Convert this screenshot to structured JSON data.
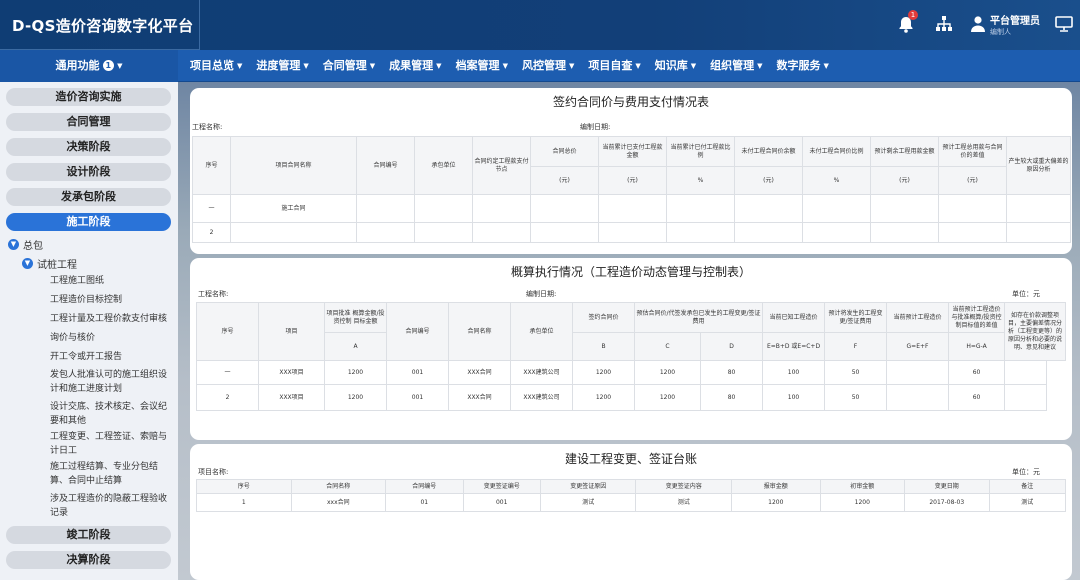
{
  "app": {
    "title": "D-QS造价咨询数字化平台",
    "notification_count": "1",
    "user_name": "平台管理员",
    "user_role": "编制人"
  },
  "nav": {
    "common": "通用功能",
    "common_count": "1",
    "items": [
      "项目总览",
      "进度管理",
      "合同管理",
      "成果管理",
      "档案管理",
      "风控管理",
      "项目自查",
      "知识库",
      "组织管理",
      "数字服务"
    ]
  },
  "sidebar": {
    "top_stages": [
      "造价咨询实施",
      "合同管理",
      "决策阶段",
      "设计阶段",
      "发承包阶段",
      "施工阶段"
    ],
    "tree": {
      "root": "总包",
      "child": "试桩工程"
    },
    "sub_items": [
      "工程施工图纸",
      "工程造价目标控制",
      "工程计量及工程价款支付审核",
      "询价与核价",
      "开工令或开工报告",
      "发包人批准认可的施工组织设计和施工进度计划",
      "设计交底、技术核定、会议纪要和其他",
      "工程变更、工程签证、索赔与计日工",
      "施工过程结算、专业分包结算、合同中止结算",
      "涉及工程造价的隐蔽工程验收记录"
    ],
    "bottom_stages": [
      "竣工阶段",
      "决算阶段"
    ]
  },
  "panel1": {
    "title": "签约合同价与费用支付情况表",
    "project_label": "工程名称:",
    "date_label": "编制日期:",
    "headers": [
      "序号",
      "项目合同名称",
      "合同编号",
      "承包单位",
      "合同约定工程款支付节点",
      "合同总价",
      "当前累计已支付工程款金额",
      "当前累计已付工程款比例",
      "未付工程合同价余额",
      "未付工程合同价比例",
      "预计剩余工程用款金额",
      "预计工程总用款与合同价的差值",
      "产生较大或重大偏差的原因分析"
    ],
    "units": [
      "(元)",
      "(元)",
      "%",
      "(元)",
      "%",
      "(元)",
      "(元)"
    ],
    "rows": [
      [
        "一",
        "施工合同",
        "",
        "",
        "",
        "",
        "",
        "",
        "",
        "",
        "",
        "",
        ""
      ],
      [
        "2",
        "",
        "",
        "",
        "",
        "",
        "",
        "",
        "",
        "",
        "",
        "",
        ""
      ]
    ]
  },
  "panel2": {
    "title": "概算执行情况（工程造价动态管理与控制表）",
    "project_label": "工程名称:",
    "date_label": "编制日期:",
    "unit_label": "单位：元",
    "headers": [
      "序号",
      "项目",
      "项目批准 概算金额/投资控制 目标金额",
      "合同编号",
      "合同名称",
      "承包单位",
      "签约合同价",
      "预估合同价/代签发承包已发生的工程变更/签证费用",
      "当前已知工程造价",
      "预计将发生的工程变更/签证费用",
      "当前预计工程造价",
      "当前预计工程造价与批准概算/投资控制目标值的差值",
      "如存在价款调整项目，主要偏差情况分析（工程变更等）的原因分析和必要的说明、意见和建议"
    ],
    "codes": [
      "A",
      "B",
      "C",
      "D",
      "E=B+D 或E=C+D",
      "F",
      "G=E+F",
      "H=G-A"
    ],
    "rows": [
      [
        "一",
        "XXX项目",
        "1200",
        "001",
        "XXX合同",
        "XXX建筑公司",
        "1200",
        "1200",
        "80",
        "100",
        "50",
        "",
        "60",
        ""
      ],
      [
        "2",
        "XXX项目",
        "1200",
        "001",
        "XXX合同",
        "XXX建筑公司",
        "1200",
        "1200",
        "80",
        "100",
        "50",
        "",
        "60",
        ""
      ]
    ]
  },
  "panel3": {
    "title": "建设工程变更、签证台账",
    "project_label": "项目名称:",
    "unit_label": "单位：元",
    "headers": [
      "序号",
      "合同名称",
      "合同编号",
      "变更签证编号",
      "变更签证原因",
      "变更签证内容",
      "报审金额",
      "初审金额",
      "变更日期",
      "备注"
    ],
    "rows": [
      [
        "1",
        "xxx合同",
        "01",
        "001",
        "测试",
        "测试",
        "1200",
        "1200",
        "2017-08-03",
        "测试"
      ]
    ]
  }
}
